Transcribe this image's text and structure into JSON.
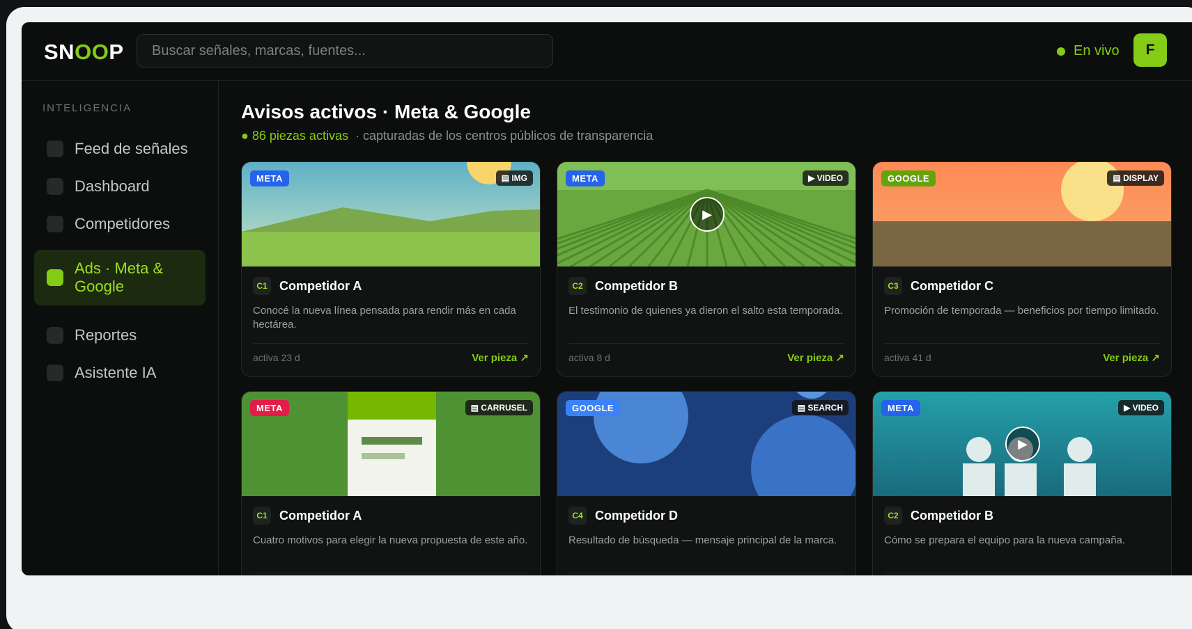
{
  "header": {
    "logo_a": "SN",
    "logo_b": "OO",
    "logo_c": "P",
    "search_placeholder": "Buscar señales, marcas, fuentes...",
    "live_label": "En vivo",
    "avatar_initial": "F"
  },
  "sidebar": {
    "section_label": "INTELIGENCIA",
    "items": [
      {
        "label": "Feed de señales",
        "active": false
      },
      {
        "label": "Dashboard",
        "active": false
      },
      {
        "label": "Competidores",
        "active": false
      },
      {
        "label": "Ads · Meta & Google",
        "active": true
      },
      {
        "label": "Reportes",
        "active": false
      },
      {
        "label": "Asistente IA",
        "active": false
      }
    ]
  },
  "main": {
    "title": "Avisos activos · Meta & Google",
    "count": "● 86 piezas activas",
    "subtitle": "· capturadas de los centros públicos de transparencia"
  },
  "cards": [
    {
      "platform": "META",
      "platform_color": "#2563eb",
      "format": "▤ IMG",
      "code": "C1",
      "competitor": "Competidor A",
      "desc": "Conocé la nueva línea pensada para rendir más en cada hectárea.",
      "active": "activa 23 d",
      "cta": "Ver pieza ↗",
      "scene": "hills"
    },
    {
      "platform": "META",
      "platform_color": "#2563eb",
      "format": "▶ VIDEO",
      "code": "C2",
      "competitor": "Competidor B",
      "desc": "El testimonio de quienes ya dieron el salto esta temporada.",
      "active": "activa 8 d",
      "cta": "Ver pieza ↗",
      "scene": "field"
    },
    {
      "platform": "GOOGLE",
      "platform_color": "#65a30d",
      "format": "▤ DISPLAY",
      "code": "C3",
      "competitor": "Competidor C",
      "desc": "Promoción de temporada — beneficios por tiempo limitado.",
      "active": "activa 41 d",
      "cta": "Ver pieza ↗",
      "scene": "sunset"
    },
    {
      "platform": "META",
      "platform_color": "#e11d48",
      "format": "▤ CARRUSEL",
      "code": "C1",
      "competitor": "Competidor A",
      "desc": "Cuatro motivos para elegir la nueva propuesta de este año.",
      "active": "",
      "cta": "",
      "scene": "carousel"
    },
    {
      "platform": "GOOGLE",
      "platform_color": "#3b82f6",
      "format": "▤ SEARCH",
      "code": "C4",
      "competitor": "Competidor D",
      "desc": "Resultado de búsqueda — mensaje principal de la marca.",
      "active": "",
      "cta": "",
      "scene": "circles"
    },
    {
      "platform": "META",
      "platform_color": "#2563eb",
      "format": "▶ VIDEO",
      "code": "C2",
      "competitor": "Competidor B",
      "desc": "Cómo se prepara el equipo para la nueva campaña.",
      "active": "",
      "cta": "",
      "scene": "team"
    }
  ]
}
